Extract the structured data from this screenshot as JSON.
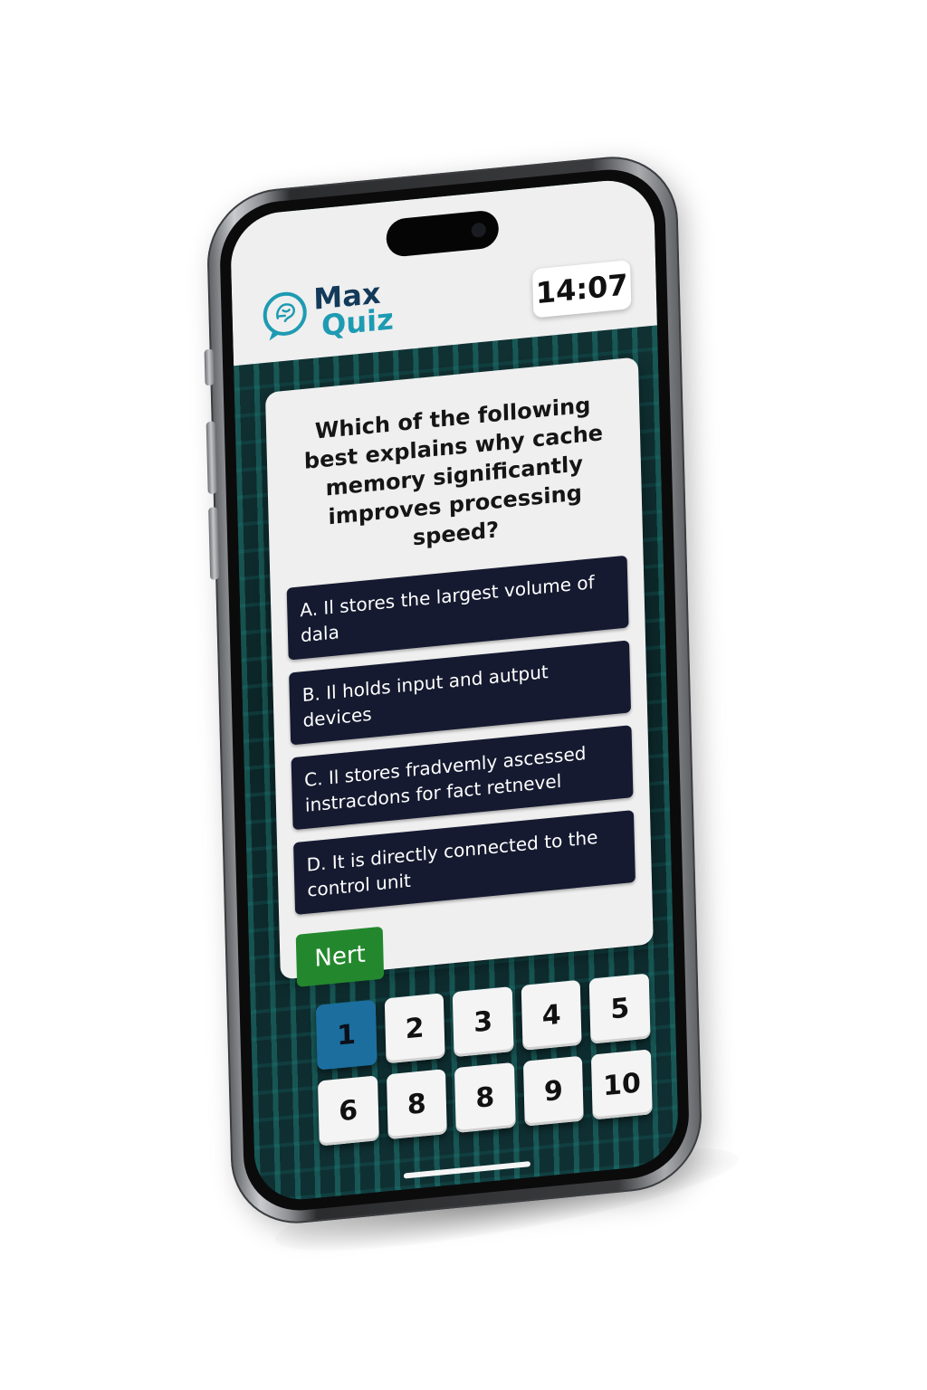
{
  "app": {
    "logo_line1": "Max",
    "logo_line2": "Quiz",
    "timer": "14:07"
  },
  "question": {
    "text": "Which of the following best explains why cache memory significantly improves processing speed?",
    "options": [
      {
        "label": "A. Il stores the largest volume of dala"
      },
      {
        "label": "B. Il holds input and autput devices"
      },
      {
        "label": "C. Il stores fradvemly ascessed instracdons for fact retnevel"
      },
      {
        "label": "D. It is directly connected to the control unit"
      }
    ],
    "next_label": "Nert"
  },
  "navigator": {
    "row1": [
      "1",
      "2",
      "3",
      "4",
      "5"
    ],
    "row2": [
      "6",
      "8",
      "8",
      "9",
      "10"
    ],
    "active": "1"
  },
  "colors": {
    "brand_dark": "#143a5a",
    "brand_light": "#1e9bb2",
    "option_bg": "#151a30",
    "next_bg": "#23882d",
    "active_num": "#1c6e9e"
  }
}
